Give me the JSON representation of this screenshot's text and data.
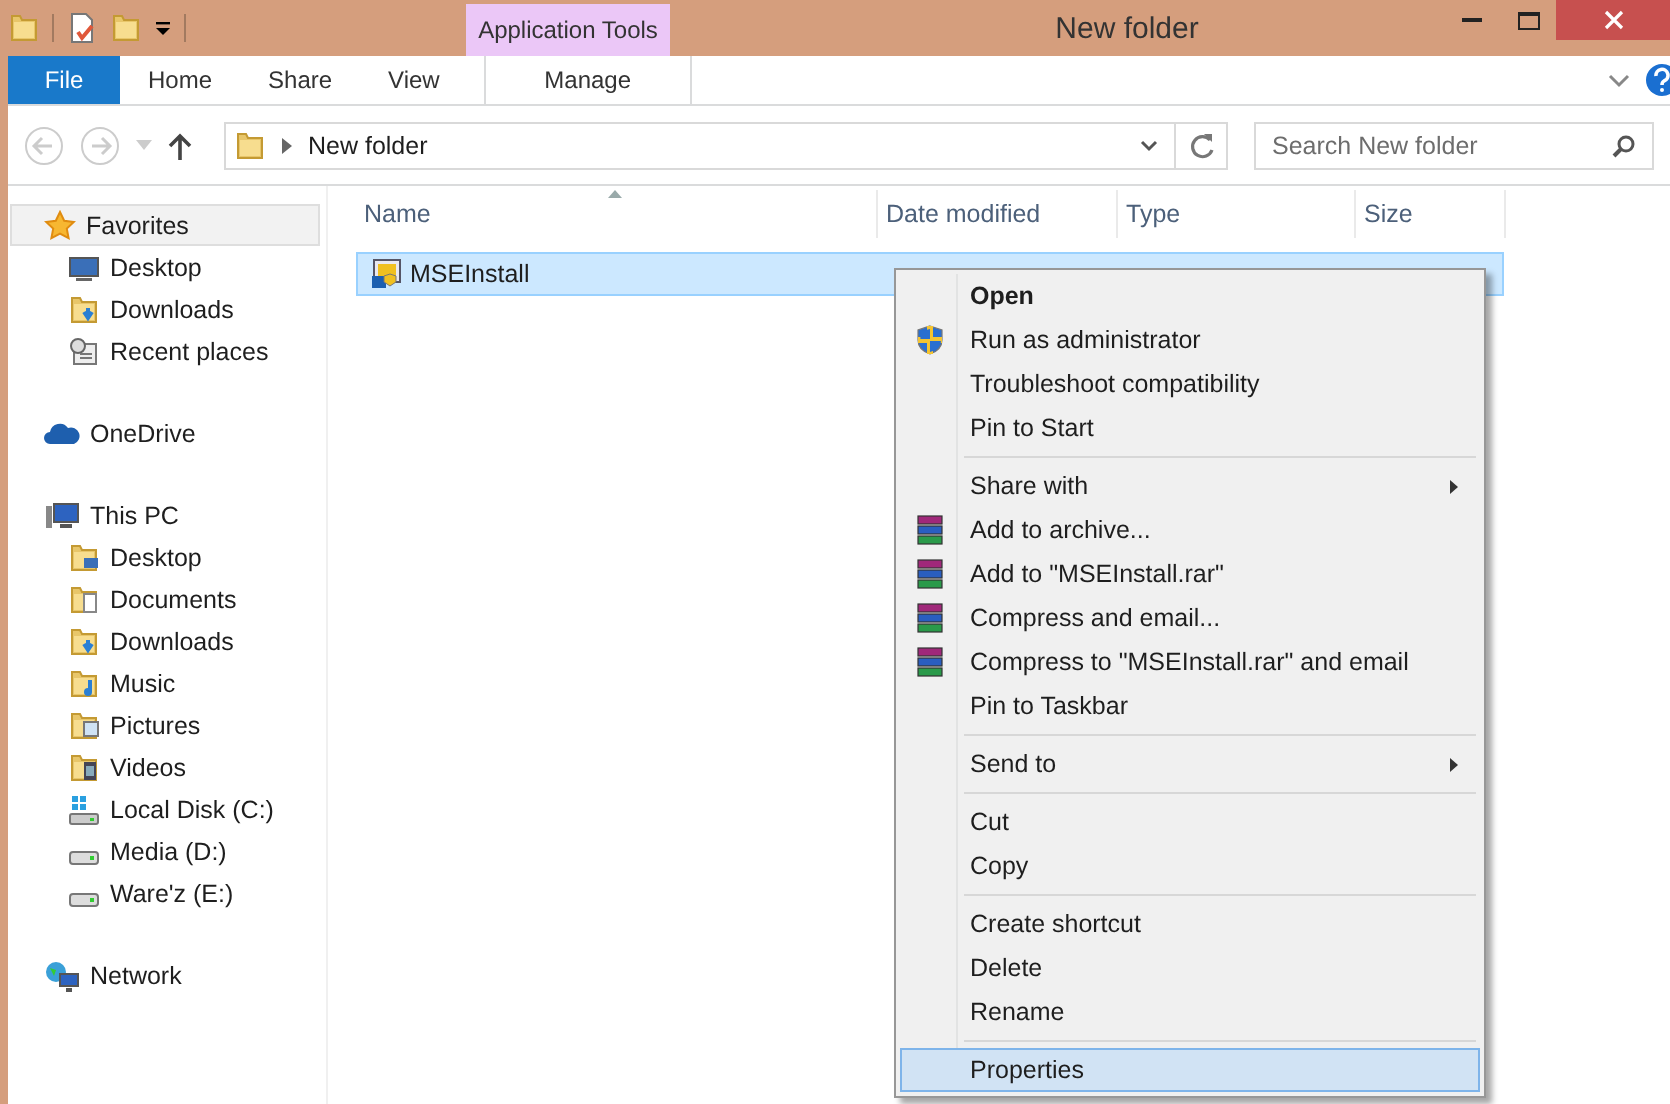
{
  "window": {
    "title": "New folder"
  },
  "ribbon": {
    "context_group": "Application Tools",
    "tabs": [
      {
        "label": "File",
        "kind": "file",
        "selected": false
      },
      {
        "label": "Home",
        "kind": "normal",
        "selected": false
      },
      {
        "label": "Share",
        "kind": "normal",
        "selected": false
      },
      {
        "label": "View",
        "kind": "normal",
        "selected": false
      },
      {
        "label": "Manage",
        "kind": "context",
        "selected": false
      }
    ]
  },
  "address_bar": {
    "path": [
      "New folder"
    ]
  },
  "search": {
    "placeholder": "Search New folder"
  },
  "navigation": [
    {
      "label": "Favorites",
      "kind": "star",
      "selected": true,
      "children": [
        {
          "label": "Desktop",
          "kind": "desktop",
          "selected": false
        },
        {
          "label": "Downloads",
          "kind": "downloads",
          "selected": false
        },
        {
          "label": "Recent places",
          "kind": "recent",
          "selected": false
        }
      ]
    },
    {
      "label": "OneDrive",
      "kind": "cloud",
      "selected": false
    },
    {
      "label": "This PC",
      "kind": "pc",
      "selected": false,
      "children": [
        {
          "label": "Desktop",
          "kind": "folder-desktop",
          "selected": false
        },
        {
          "label": "Documents",
          "kind": "documents",
          "selected": false
        },
        {
          "label": "Downloads",
          "kind": "downloads",
          "selected": false
        },
        {
          "label": "Music",
          "kind": "music",
          "selected": false
        },
        {
          "label": "Pictures",
          "kind": "pictures",
          "selected": false
        },
        {
          "label": "Videos",
          "kind": "videos",
          "selected": false
        },
        {
          "label": "Local Disk (C:)",
          "kind": "system-disk",
          "selected": false
        },
        {
          "label": "Media (D:)",
          "kind": "disk",
          "selected": false
        },
        {
          "label": "Ware'z (E:)",
          "kind": "disk",
          "selected": false
        }
      ]
    },
    {
      "label": "Network",
      "kind": "network",
      "selected": false
    }
  ],
  "file_list": {
    "columns": [
      {
        "label": "Name",
        "sorted": true
      },
      {
        "label": "Date modified",
        "sorted": false
      },
      {
        "label": "Type",
        "sorted": false
      },
      {
        "label": "Size",
        "sorted": false
      }
    ],
    "rows": [
      {
        "name": "MSEInstall",
        "selected": true
      }
    ]
  },
  "context_menu": [
    {
      "kind": "plain",
      "label": "Open",
      "default": true,
      "submenu": false,
      "selected": false
    },
    {
      "kind": "admin",
      "label": "Run as administrator",
      "default": false,
      "submenu": false,
      "selected": false
    },
    {
      "kind": "plain",
      "label": "Troubleshoot compatibility",
      "default": false,
      "submenu": false,
      "selected": false
    },
    {
      "kind": "plain",
      "label": "Pin to Start",
      "default": false,
      "submenu": false,
      "selected": false
    },
    {
      "kind": "separator"
    },
    {
      "kind": "plain",
      "label": "Share with",
      "default": false,
      "submenu": true,
      "selected": false
    },
    {
      "kind": "archive",
      "label": "Add to archive...",
      "default": false,
      "submenu": false,
      "selected": false
    },
    {
      "kind": "archive",
      "label": "Add to \"MSEInstall.rar\"",
      "default": false,
      "submenu": false,
      "selected": false
    },
    {
      "kind": "archive",
      "label": "Compress and email...",
      "default": false,
      "submenu": false,
      "selected": false
    },
    {
      "kind": "archive",
      "label": "Compress to \"MSEInstall.rar\" and email",
      "default": false,
      "submenu": false,
      "selected": false
    },
    {
      "kind": "plain",
      "label": "Pin to Taskbar",
      "default": false,
      "submenu": false,
      "selected": false
    },
    {
      "kind": "separator"
    },
    {
      "kind": "plain",
      "label": "Send to",
      "default": false,
      "submenu": true,
      "selected": false
    },
    {
      "kind": "separator"
    },
    {
      "kind": "plain",
      "label": "Cut",
      "default": false,
      "submenu": false,
      "selected": false
    },
    {
      "kind": "plain",
      "label": "Copy",
      "default": false,
      "submenu": false,
      "selected": false
    },
    {
      "kind": "separator"
    },
    {
      "kind": "plain",
      "label": "Create shortcut",
      "default": false,
      "submenu": false,
      "selected": false
    },
    {
      "kind": "plain",
      "label": "Delete",
      "default": false,
      "submenu": false,
      "selected": false
    },
    {
      "kind": "plain",
      "label": "Rename",
      "default": false,
      "submenu": false,
      "selected": false
    },
    {
      "kind": "separator"
    },
    {
      "kind": "plain",
      "label": "Properties",
      "default": false,
      "submenu": false,
      "selected": true
    }
  ]
}
